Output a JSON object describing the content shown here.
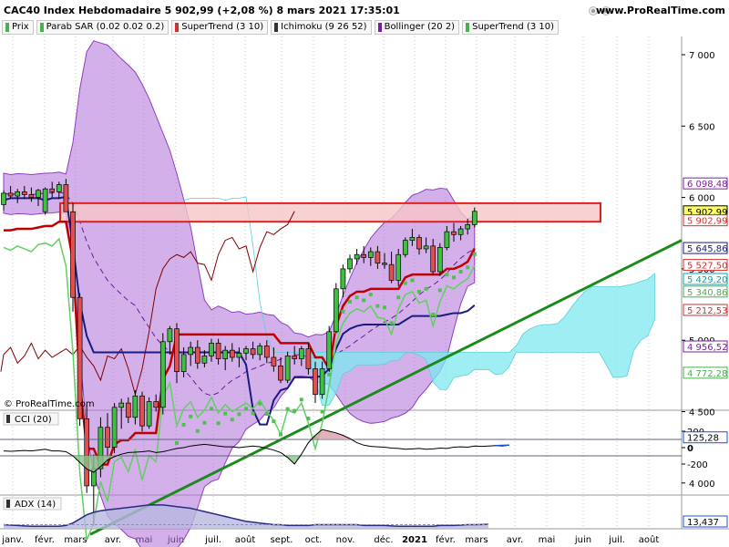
{
  "header": {
    "title": "CAC40 Index Hebdomadaire 5 902,99 (+2,08 %) 8 mars 2021 17:35:01",
    "site": "www.ProRealTime.com",
    "copyright": "© ProRealTime.com"
  },
  "legend": [
    {
      "label": "Prix",
      "color": "#4caf50"
    },
    {
      "label": "Parab SAR (0.02 0.02 0.2)",
      "color": "#4caf50"
    },
    {
      "label": "SuperTrend (3 10)",
      "color": "#d32f2f"
    },
    {
      "label": "Ichimoku (9 26 52)",
      "color": "#333333"
    },
    {
      "label": "Bollinger (20 2)",
      "color": "#7b1fa2"
    },
    {
      "label": "SuperTrend (3 10)",
      "color": "#4caf50"
    }
  ],
  "colors": {
    "bullish": "#40c040",
    "bearish": "#e05050",
    "bollinger_fill": "#b070d8",
    "cloud_fill": "#7ee8f0",
    "trendline": "#1a8a1a",
    "resistance_zone": "#f6c6c8",
    "kijun": "#1a1a80",
    "supertrend_red": "#c00000",
    "supertrend_green": "#60d060",
    "sar": "#50c050",
    "chikou": "#800000"
  },
  "chart_data": [
    {
      "type": "candlestick",
      "title": "CAC40 Index Hebdomadaire",
      "timeframe": "weekly",
      "y_ticks": [
        4000,
        4500,
        5000,
        5500,
        6000,
        6500,
        7000
      ],
      "ylim": [
        3600,
        7300
      ],
      "months": [
        "janv.",
        "févr.",
        "mars",
        "avr.",
        "mai",
        "juin",
        "juil.",
        "août",
        "sept.",
        "oct.",
        "nov.",
        "déc.",
        "2021",
        "févr.",
        "mars",
        "avr.",
        "mai",
        "juin",
        "juil.",
        "août"
      ],
      "price_badges": [
        {
          "label": "6 098,48",
          "value": 6098.48,
          "color": "#7b1fa2"
        },
        {
          "label": "5 902,99",
          "value": 5902.99,
          "color": "#000000",
          "fill": "#ffff66"
        },
        {
          "label": "5 902,99",
          "value": 5840,
          "color": "#d32f2f"
        },
        {
          "label": "5 645,86",
          "value": 5645.86,
          "color": "#1a1a80"
        },
        {
          "label": "5 527,50",
          "value": 5527.5,
          "color": "#d32f2f"
        },
        {
          "label": "5 429,20",
          "value": 5429.2,
          "color": "#00aaaa"
        },
        {
          "label": "5 340,86",
          "value": 5340.86,
          "color": "#4caf50"
        },
        {
          "label": "5 212,53",
          "value": 5212.53,
          "color": "#d32f2f"
        },
        {
          "label": "4 956,52",
          "value": 4956.52,
          "color": "#7b1fa2"
        },
        {
          "label": "4 772,28",
          "value": 4772.28,
          "color": "#4caf50"
        }
      ],
      "candles": [
        {
          "o": 5950,
          "h": 6050,
          "l": 5910,
          "c": 6030
        },
        {
          "o": 6030,
          "h": 6080,
          "l": 5990,
          "c": 6010
        },
        {
          "o": 6010,
          "h": 6060,
          "l": 5960,
          "c": 6040
        },
        {
          "o": 6040,
          "h": 6080,
          "l": 5990,
          "c": 6020
        },
        {
          "o": 6020,
          "h": 6070,
          "l": 5970,
          "c": 6000
        },
        {
          "o": 6000,
          "h": 6060,
          "l": 5940,
          "c": 6050
        },
        {
          "o": 5900,
          "h": 6070,
          "l": 5880,
          "c": 6060
        },
        {
          "o": 6060,
          "h": 6110,
          "l": 6000,
          "c": 6040
        },
        {
          "o": 6040,
          "h": 6110,
          "l": 5990,
          "c": 6090
        },
        {
          "o": 6090,
          "h": 6130,
          "l": 6010,
          "c": 5900
        },
        {
          "o": 5900,
          "h": 5960,
          "l": 5200,
          "c": 5300
        },
        {
          "o": 5300,
          "h": 5330,
          "l": 4400,
          "c": 4450
        },
        {
          "o": 4450,
          "h": 4550,
          "l": 3930,
          "c": 3980
        },
        {
          "o": 3980,
          "h": 4200,
          "l": 3700,
          "c": 4100
        },
        {
          "o": 4100,
          "h": 4460,
          "l": 4040,
          "c": 4390
        },
        {
          "o": 4390,
          "h": 4490,
          "l": 4180,
          "c": 4250
        },
        {
          "o": 4250,
          "h": 4560,
          "l": 4210,
          "c": 4530
        },
        {
          "o": 4530,
          "h": 4590,
          "l": 4380,
          "c": 4560
        },
        {
          "o": 4560,
          "h": 4600,
          "l": 4420,
          "c": 4460
        },
        {
          "o": 4460,
          "h": 4650,
          "l": 4410,
          "c": 4610
        },
        {
          "o": 4610,
          "h": 4640,
          "l": 4360,
          "c": 4400
        },
        {
          "o": 4400,
          "h": 4600,
          "l": 4380,
          "c": 4570
        },
        {
          "o": 4570,
          "h": 4620,
          "l": 4500,
          "c": 4530
        },
        {
          "o": 4530,
          "h": 5050,
          "l": 4480,
          "c": 4990
        },
        {
          "o": 4990,
          "h": 5100,
          "l": 4900,
          "c": 5080
        },
        {
          "o": 5080,
          "h": 5120,
          "l": 4700,
          "c": 4780
        },
        {
          "o": 4780,
          "h": 4950,
          "l": 4740,
          "c": 4900
        },
        {
          "o": 4900,
          "h": 4990,
          "l": 4820,
          "c": 4950
        },
        {
          "o": 4950,
          "h": 5000,
          "l": 4800,
          "c": 4840
        },
        {
          "o": 4840,
          "h": 4930,
          "l": 4810,
          "c": 4890
        },
        {
          "o": 4890,
          "h": 5010,
          "l": 4850,
          "c": 4980
        },
        {
          "o": 4980,
          "h": 5010,
          "l": 4830,
          "c": 4870
        },
        {
          "o": 4870,
          "h": 4960,
          "l": 4790,
          "c": 4930
        },
        {
          "o": 4930,
          "h": 4980,
          "l": 4850,
          "c": 4880
        },
        {
          "o": 4880,
          "h": 4950,
          "l": 4810,
          "c": 4910
        },
        {
          "o": 4910,
          "h": 4960,
          "l": 4860,
          "c": 4940
        },
        {
          "o": 4940,
          "h": 4990,
          "l": 4870,
          "c": 4900
        },
        {
          "o": 4900,
          "h": 4980,
          "l": 4860,
          "c": 4960
        },
        {
          "o": 4960,
          "h": 5000,
          "l": 4840,
          "c": 4880
        },
        {
          "o": 4880,
          "h": 4950,
          "l": 4780,
          "c": 4820
        },
        {
          "o": 4820,
          "h": 4880,
          "l": 4700,
          "c": 4720
        },
        {
          "o": 4720,
          "h": 4920,
          "l": 4700,
          "c": 4890
        },
        {
          "o": 4890,
          "h": 4960,
          "l": 4830,
          "c": 4870
        },
        {
          "o": 4870,
          "h": 4960,
          "l": 4820,
          "c": 4940
        },
        {
          "o": 4940,
          "h": 4980,
          "l": 4760,
          "c": 4800
        },
        {
          "o": 4800,
          "h": 4850,
          "l": 4560,
          "c": 4620
        },
        {
          "o": 4620,
          "h": 4850,
          "l": 4590,
          "c": 4800
        },
        {
          "o": 4800,
          "h": 5100,
          "l": 4780,
          "c": 5060
        },
        {
          "o": 5060,
          "h": 5400,
          "l": 5050,
          "c": 5360
        },
        {
          "o": 5360,
          "h": 5530,
          "l": 5300,
          "c": 5500
        },
        {
          "o": 5500,
          "h": 5600,
          "l": 5470,
          "c": 5570
        },
        {
          "o": 5570,
          "h": 5640,
          "l": 5530,
          "c": 5600
        },
        {
          "o": 5600,
          "h": 5660,
          "l": 5540,
          "c": 5580
        },
        {
          "o": 5580,
          "h": 5650,
          "l": 5520,
          "c": 5620
        },
        {
          "o": 5620,
          "h": 5660,
          "l": 5500,
          "c": 5540
        },
        {
          "o": 5540,
          "h": 5610,
          "l": 5500,
          "c": 5530
        },
        {
          "o": 5530,
          "h": 5620,
          "l": 5400,
          "c": 5420
        },
        {
          "o": 5420,
          "h": 5640,
          "l": 5380,
          "c": 5600
        },
        {
          "o": 5600,
          "h": 5720,
          "l": 5580,
          "c": 5700
        },
        {
          "o": 5700,
          "h": 5780,
          "l": 5660,
          "c": 5720
        },
        {
          "o": 5720,
          "h": 5740,
          "l": 5600,
          "c": 5640
        },
        {
          "o": 5640,
          "h": 5720,
          "l": 5610,
          "c": 5660
        },
        {
          "o": 5660,
          "h": 5710,
          "l": 5460,
          "c": 5480
        },
        {
          "o": 5480,
          "h": 5680,
          "l": 5450,
          "c": 5650
        },
        {
          "o": 5650,
          "h": 5800,
          "l": 5630,
          "c": 5760
        },
        {
          "o": 5760,
          "h": 5820,
          "l": 5690,
          "c": 5740
        },
        {
          "o": 5740,
          "h": 5800,
          "l": 5700,
          "c": 5780
        },
        {
          "o": 5780,
          "h": 5850,
          "l": 5740,
          "c": 5810
        },
        {
          "o": 5810,
          "h": 5930,
          "l": 5790,
          "c": 5903
        }
      ]
    },
    {
      "type": "line",
      "title": "CCI (20)",
      "y_ticks": [
        200,
        0,
        -200
      ],
      "ylim": [
        -320,
        260
      ],
      "values": [
        -40,
        -45,
        -40,
        -35,
        -40,
        -30,
        -20,
        -40,
        -40,
        -50,
        -100,
        -180,
        -260,
        -300,
        -230,
        -150,
        -110,
        -80,
        -60,
        -55,
        -50,
        -40,
        -60,
        -50,
        -30,
        -10,
        0,
        20,
        30,
        40,
        30,
        20,
        10,
        10,
        0,
        10,
        20,
        10,
        -10,
        -30,
        -60,
        -120,
        -200,
        -80,
        60,
        150,
        220,
        200,
        180,
        150,
        110,
        60,
        30,
        15,
        10,
        5,
        -5,
        -10,
        -20,
        -15,
        -10,
        -20,
        -15,
        -5,
        -10,
        5,
        10,
        5,
        20,
        15,
        20,
        25,
        20,
        30
      ],
      "last_value_label": "125,28"
    },
    {
      "type": "line",
      "title": "ADX (14)",
      "values": [
        13,
        12.5,
        12,
        11.5,
        11,
        11,
        11,
        11,
        11,
        12,
        15,
        20,
        25,
        28,
        30,
        31,
        32,
        33,
        34,
        35,
        36,
        37,
        37,
        37,
        36,
        35,
        34,
        33,
        31,
        29,
        27,
        25,
        23,
        21,
        19,
        17,
        16,
        15,
        14,
        13,
        13,
        12,
        12,
        12,
        12,
        13,
        13,
        13,
        13,
        13,
        13,
        13,
        12,
        12,
        12,
        12,
        11.5,
        11,
        11,
        11,
        11,
        11,
        11,
        12,
        12,
        12,
        12.5,
        13,
        13,
        13.2,
        13.4
      ],
      "last_value_label": "13,437",
      "ylim": [
        8,
        40
      ]
    }
  ]
}
